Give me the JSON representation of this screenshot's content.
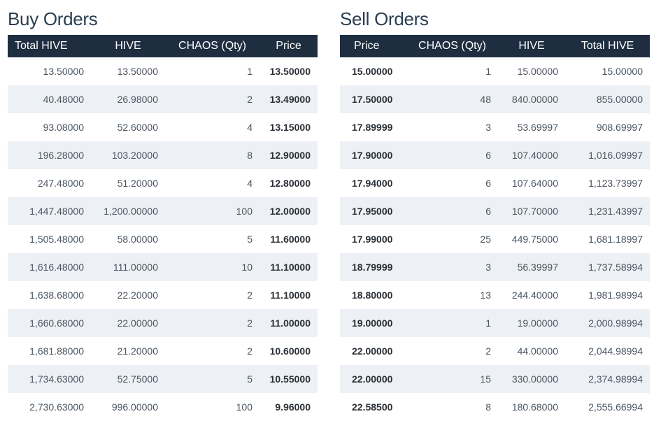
{
  "buy": {
    "title": "Buy Orders",
    "headers": {
      "total": "Total HIVE",
      "hive": "HIVE",
      "chaos": "CHAOS (Qty)",
      "price": "Price"
    },
    "rows": [
      {
        "total": "13.50000",
        "hive": "13.50000",
        "chaos": "1",
        "price": "13.50000"
      },
      {
        "total": "40.48000",
        "hive": "26.98000",
        "chaos": "2",
        "price": "13.49000"
      },
      {
        "total": "93.08000",
        "hive": "52.60000",
        "chaos": "4",
        "price": "13.15000"
      },
      {
        "total": "196.28000",
        "hive": "103.20000",
        "chaos": "8",
        "price": "12.90000"
      },
      {
        "total": "247.48000",
        "hive": "51.20000",
        "chaos": "4",
        "price": "12.80000"
      },
      {
        "total": "1,447.48000",
        "hive": "1,200.00000",
        "chaos": "100",
        "price": "12.00000"
      },
      {
        "total": "1,505.48000",
        "hive": "58.00000",
        "chaos": "5",
        "price": "11.60000"
      },
      {
        "total": "1,616.48000",
        "hive": "111.00000",
        "chaos": "10",
        "price": "11.10000"
      },
      {
        "total": "1,638.68000",
        "hive": "22.20000",
        "chaos": "2",
        "price": "11.10000"
      },
      {
        "total": "1,660.68000",
        "hive": "22.00000",
        "chaos": "2",
        "price": "11.00000"
      },
      {
        "total": "1,681.88000",
        "hive": "21.20000",
        "chaos": "2",
        "price": "10.60000"
      },
      {
        "total": "1,734.63000",
        "hive": "52.75000",
        "chaos": "5",
        "price": "10.55000"
      },
      {
        "total": "2,730.63000",
        "hive": "996.00000",
        "chaos": "100",
        "price": "9.96000"
      }
    ]
  },
  "sell": {
    "title": "Sell Orders",
    "headers": {
      "price": "Price",
      "chaos": "CHAOS (Qty)",
      "hive": "HIVE",
      "total": "Total HIVE"
    },
    "rows": [
      {
        "price": "15.00000",
        "chaos": "1",
        "hive": "15.00000",
        "total": "15.00000"
      },
      {
        "price": "17.50000",
        "chaos": "48",
        "hive": "840.00000",
        "total": "855.00000"
      },
      {
        "price": "17.89999",
        "chaos": "3",
        "hive": "53.69997",
        "total": "908.69997"
      },
      {
        "price": "17.90000",
        "chaos": "6",
        "hive": "107.40000",
        "total": "1,016.09997"
      },
      {
        "price": "17.94000",
        "chaos": "6",
        "hive": "107.64000",
        "total": "1,123.73997"
      },
      {
        "price": "17.95000",
        "chaos": "6",
        "hive": "107.70000",
        "total": "1,231.43997"
      },
      {
        "price": "17.99000",
        "chaos": "25",
        "hive": "449.75000",
        "total": "1,681.18997"
      },
      {
        "price": "18.79999",
        "chaos": "3",
        "hive": "56.39997",
        "total": "1,737.58994"
      },
      {
        "price": "18.80000",
        "chaos": "13",
        "hive": "244.40000",
        "total": "1,981.98994"
      },
      {
        "price": "19.00000",
        "chaos": "1",
        "hive": "19.00000",
        "total": "2,000.98994"
      },
      {
        "price": "22.00000",
        "chaos": "2",
        "hive": "44.00000",
        "total": "2,044.98994"
      },
      {
        "price": "22.00000",
        "chaos": "15",
        "hive": "330.00000",
        "total": "2,374.98994"
      },
      {
        "price": "22.58500",
        "chaos": "8",
        "hive": "180.68000",
        "total": "2,555.66994"
      }
    ]
  }
}
